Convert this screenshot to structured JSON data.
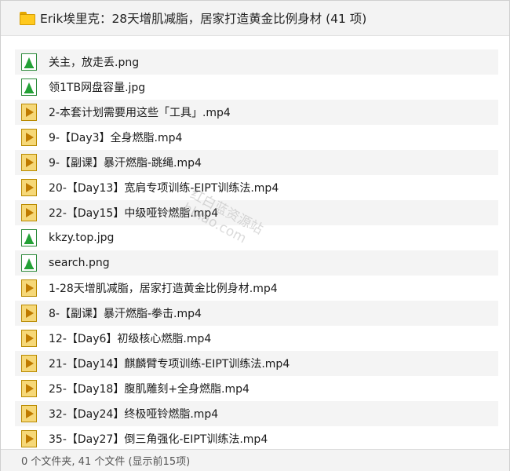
{
  "header": {
    "folder_icon": "folder-icon",
    "title": "Erik埃里克：28天增肌减脂，居家打造黄金比例身材 (41 项)"
  },
  "files": [
    {
      "name": "关主，放走丢.png",
      "type": "image"
    },
    {
      "name": "领1TB网盘容量.jpg",
      "type": "image"
    },
    {
      "name": "2-本套计划需要用这些「工具」.mp4",
      "type": "video"
    },
    {
      "name": "9-【Day3】全身燃脂.mp4",
      "type": "video"
    },
    {
      "name": "9-【副课】暴汗燃脂-跳绳.mp4",
      "type": "video"
    },
    {
      "name": "20-【Day13】宽肩专项训练-EIPT训练法.mp4",
      "type": "video"
    },
    {
      "name": "22-【Day15】中级哑铃燃脂.mp4",
      "type": "video"
    },
    {
      "name": "kkzy.top.jpg",
      "type": "image"
    },
    {
      "name": "search.png",
      "type": "image"
    },
    {
      "name": "1-28天增肌减脂，居家打造黄金比例身材.mp4",
      "type": "video"
    },
    {
      "name": "8-【副课】暴汗燃脂-拳击.mp4",
      "type": "video"
    },
    {
      "name": "12-【Day6】初级核心燃脂.mp4",
      "type": "video"
    },
    {
      "name": "21-【Day14】麒麟臂专项训练-EIPT训练法.mp4",
      "type": "video"
    },
    {
      "name": "25-【Day18】腹肌雕刻+全身燃脂.mp4",
      "type": "video"
    },
    {
      "name": "32-【Day24】终极哑铃燃脂.mp4",
      "type": "video"
    },
    {
      "name": "35-【Day27】倒三角强化-EIPT训练法.mp4",
      "type": "video"
    }
  ],
  "watermark": {
    "line1": "红白蓝资源站",
    "line2": "hbiao.com"
  },
  "status": {
    "text": "0 个文件夹, 41 个文件 (显示前15项)"
  },
  "colors": {
    "folder": "#ffc91e",
    "image_icon": "#23a136",
    "video_icon": "#f6d878"
  }
}
